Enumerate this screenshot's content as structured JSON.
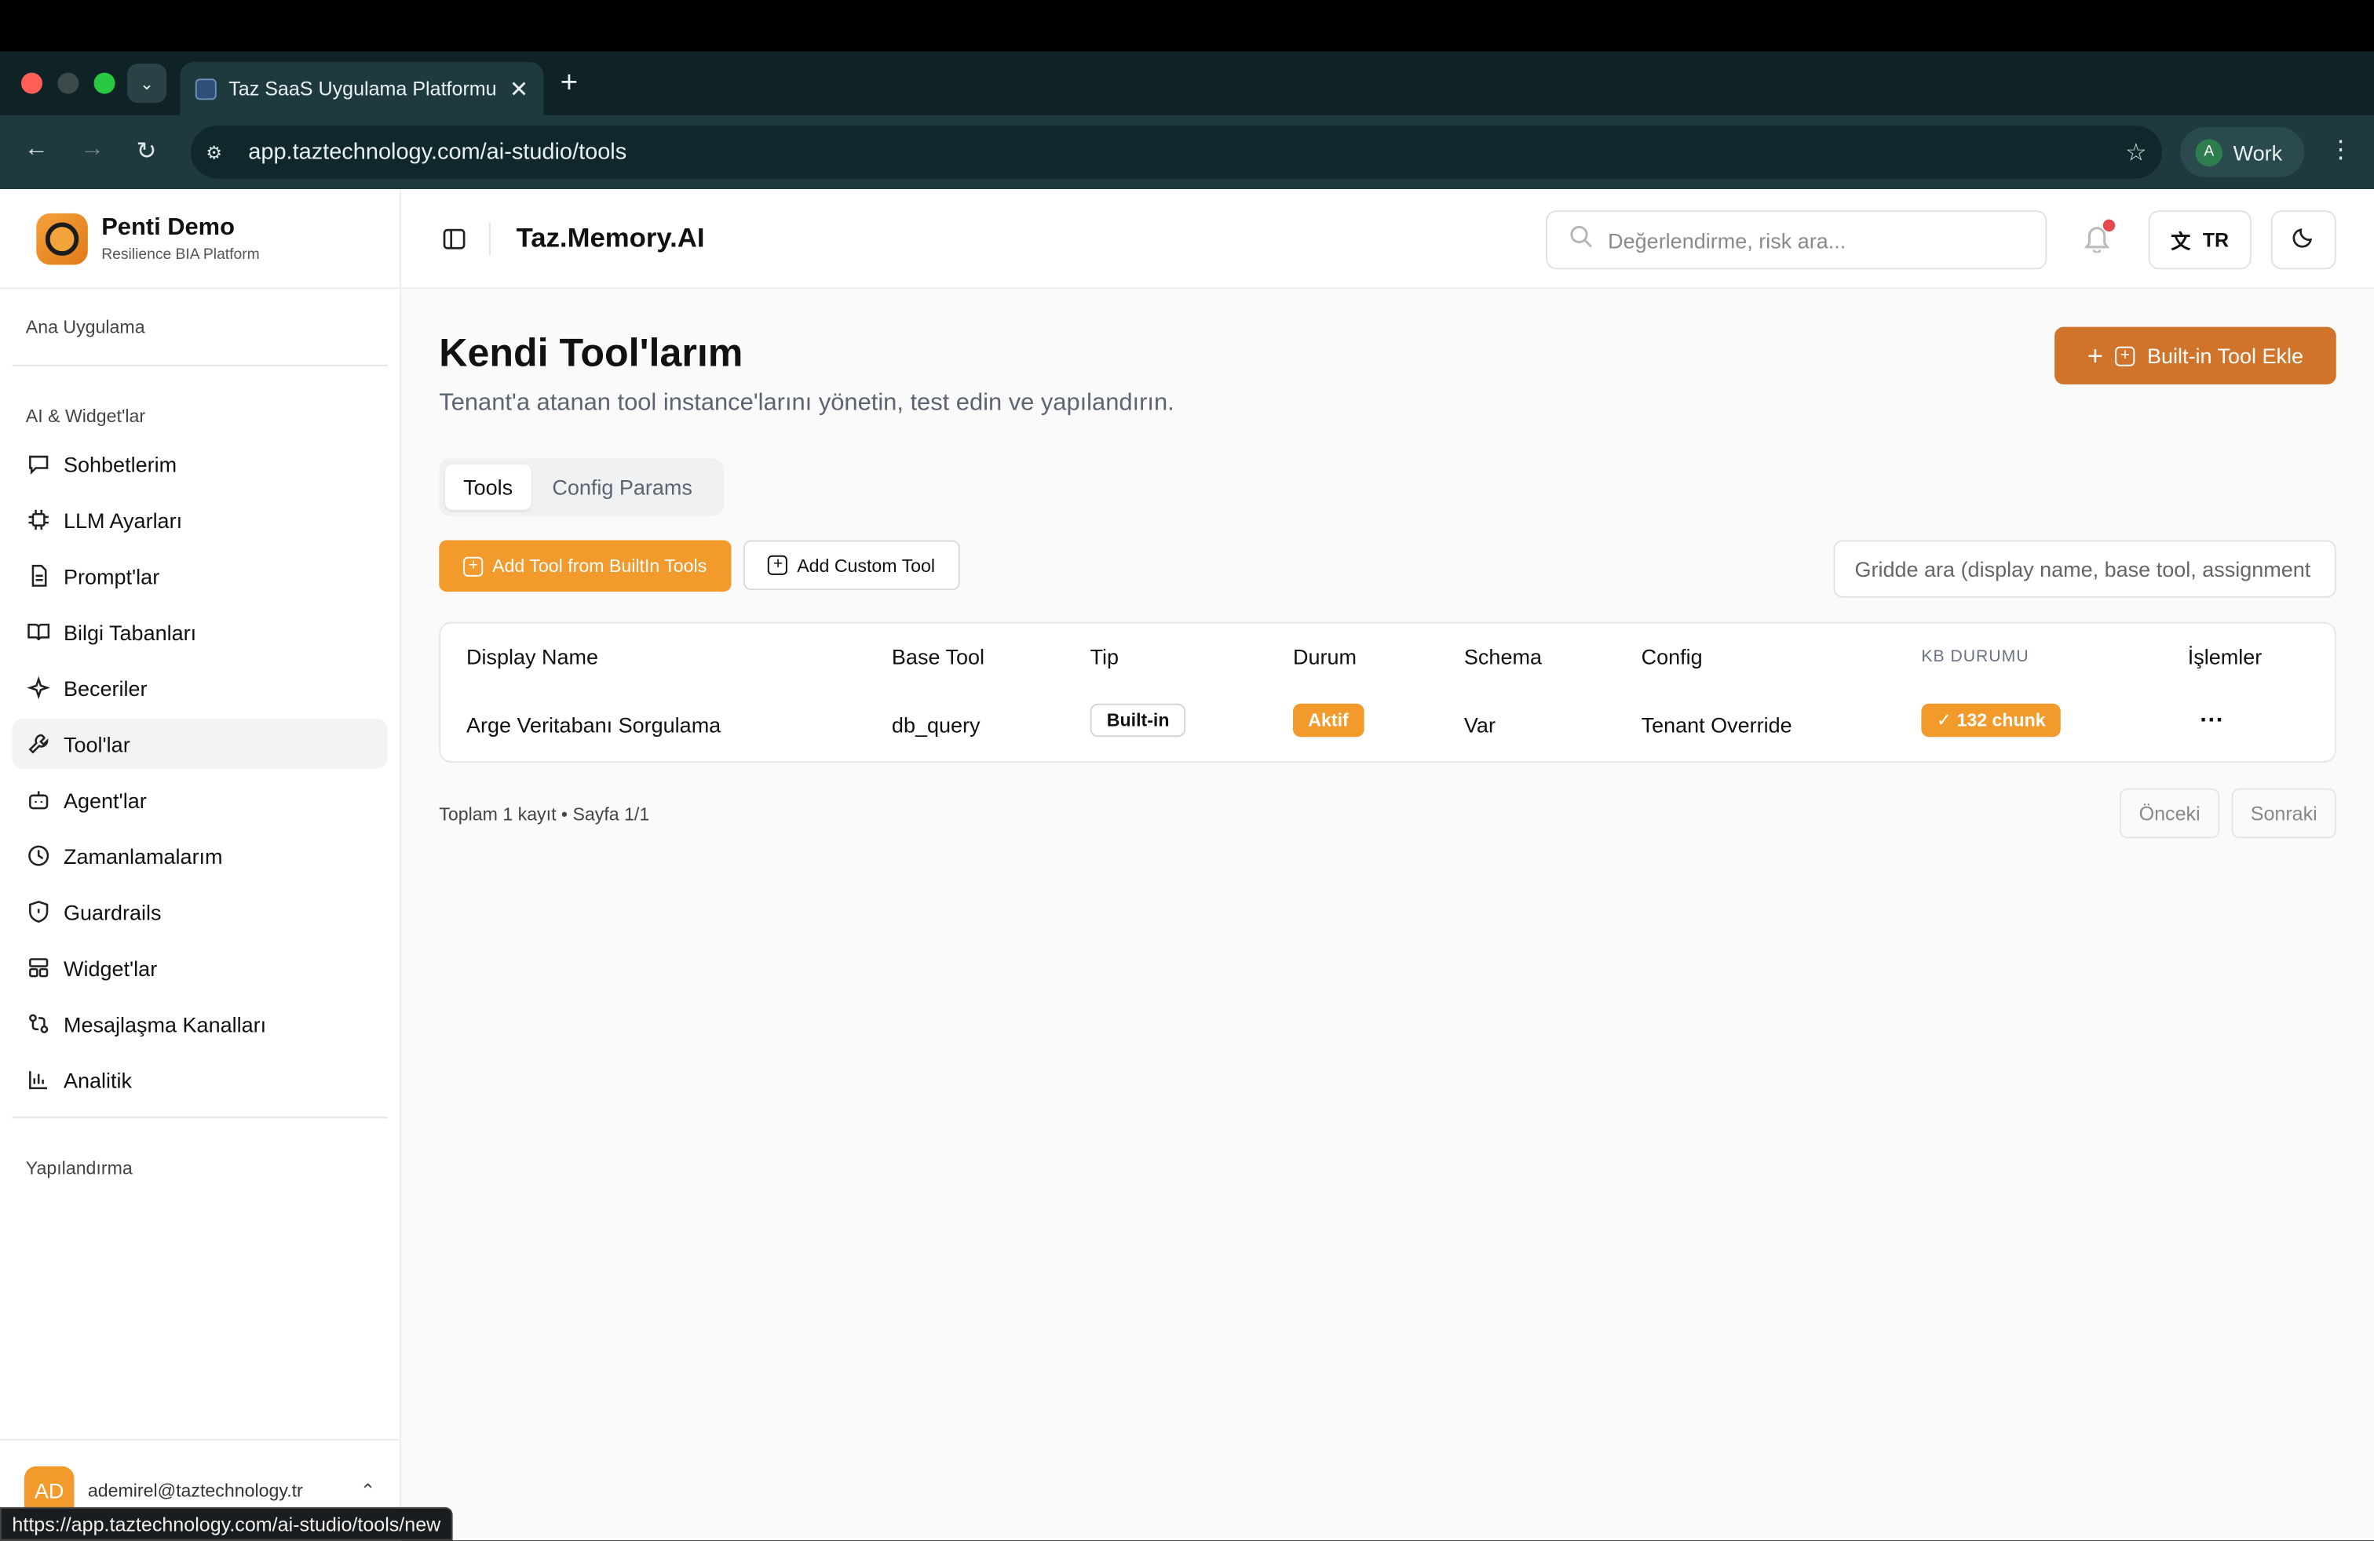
{
  "browser": {
    "tab_title": "Taz SaaS Uygulama Platformu",
    "url": "app.taztechnology.com/ai-studio/tools",
    "profile_initial": "A",
    "profile_label": "Work",
    "status_url": "https://app.taztechnology.com/ai-studio/tools/new"
  },
  "sidebar": {
    "brand_title": "Penti Demo",
    "brand_subtitle": "Resilience BIA Platform",
    "section_main": "Ana Uygulama",
    "section_ai": "AI & Widget'lar",
    "items": [
      {
        "label": "Sohbetlerim",
        "icon": "chat-icon"
      },
      {
        "label": "LLM Ayarları",
        "icon": "chip-icon"
      },
      {
        "label": "Prompt'lar",
        "icon": "document-icon"
      },
      {
        "label": "Bilgi Tabanları",
        "icon": "book-icon"
      },
      {
        "label": "Beceriler",
        "icon": "sparkle-icon"
      },
      {
        "label": "Tool'lar",
        "icon": "wrench-icon",
        "active": true
      },
      {
        "label": "Agent'lar",
        "icon": "bot-icon"
      },
      {
        "label": "Zamanlamalarım",
        "icon": "clock-icon"
      },
      {
        "label": "Guardrails",
        "icon": "shield-icon"
      },
      {
        "label": "Widget'lar",
        "icon": "layout-icon"
      },
      {
        "label": "Mesajlaşma Kanalları",
        "icon": "channels-icon"
      },
      {
        "label": "Analitik",
        "icon": "bar-chart-icon"
      }
    ],
    "section_config": "Yapılandırma",
    "user_initials": "AD",
    "user_email": "ademirel@taztechnology.tr"
  },
  "topbar": {
    "app_title": "Taz.Memory.AI",
    "search_placeholder": "Değerlendirme, risk ara...",
    "language": "TR"
  },
  "page": {
    "title": "Kendi Tool'larım",
    "subtitle": "Tenant'a atanan tool instance'larını yönetin, test edin ve yapılandırın.",
    "primary_button": "Built-in Tool Ekle",
    "tabs": [
      "Tools",
      "Config Params"
    ],
    "active_tab": "Tools",
    "add_builtin_button": "Add Tool from BuiltIn Tools",
    "add_custom_button": "Add Custom Tool",
    "grid_search_placeholder": "Gridde ara (display name, base tool, assignment"
  },
  "table": {
    "columns": [
      "Display Name",
      "Base Tool",
      "Tip",
      "Durum",
      "Schema",
      "Config",
      "KB DURUMU",
      "İşlemler"
    ],
    "rows": [
      {
        "display_name": "Arge Veritabanı Sorgulama",
        "base_tool": "db_query",
        "tip": "Built-in",
        "durum": "Aktif",
        "schema": "Var",
        "config": "Tenant Override",
        "kb_durumu": "✓ 132 chunk",
        "actions": "···"
      }
    ]
  },
  "pagination": {
    "summary": "Toplam 1 kayıt • Sayfa 1/1",
    "prev": "Önceki",
    "next": "Sonraki"
  },
  "colors": {
    "accent": "#f39a2c",
    "primary_button": "#d0742b"
  }
}
